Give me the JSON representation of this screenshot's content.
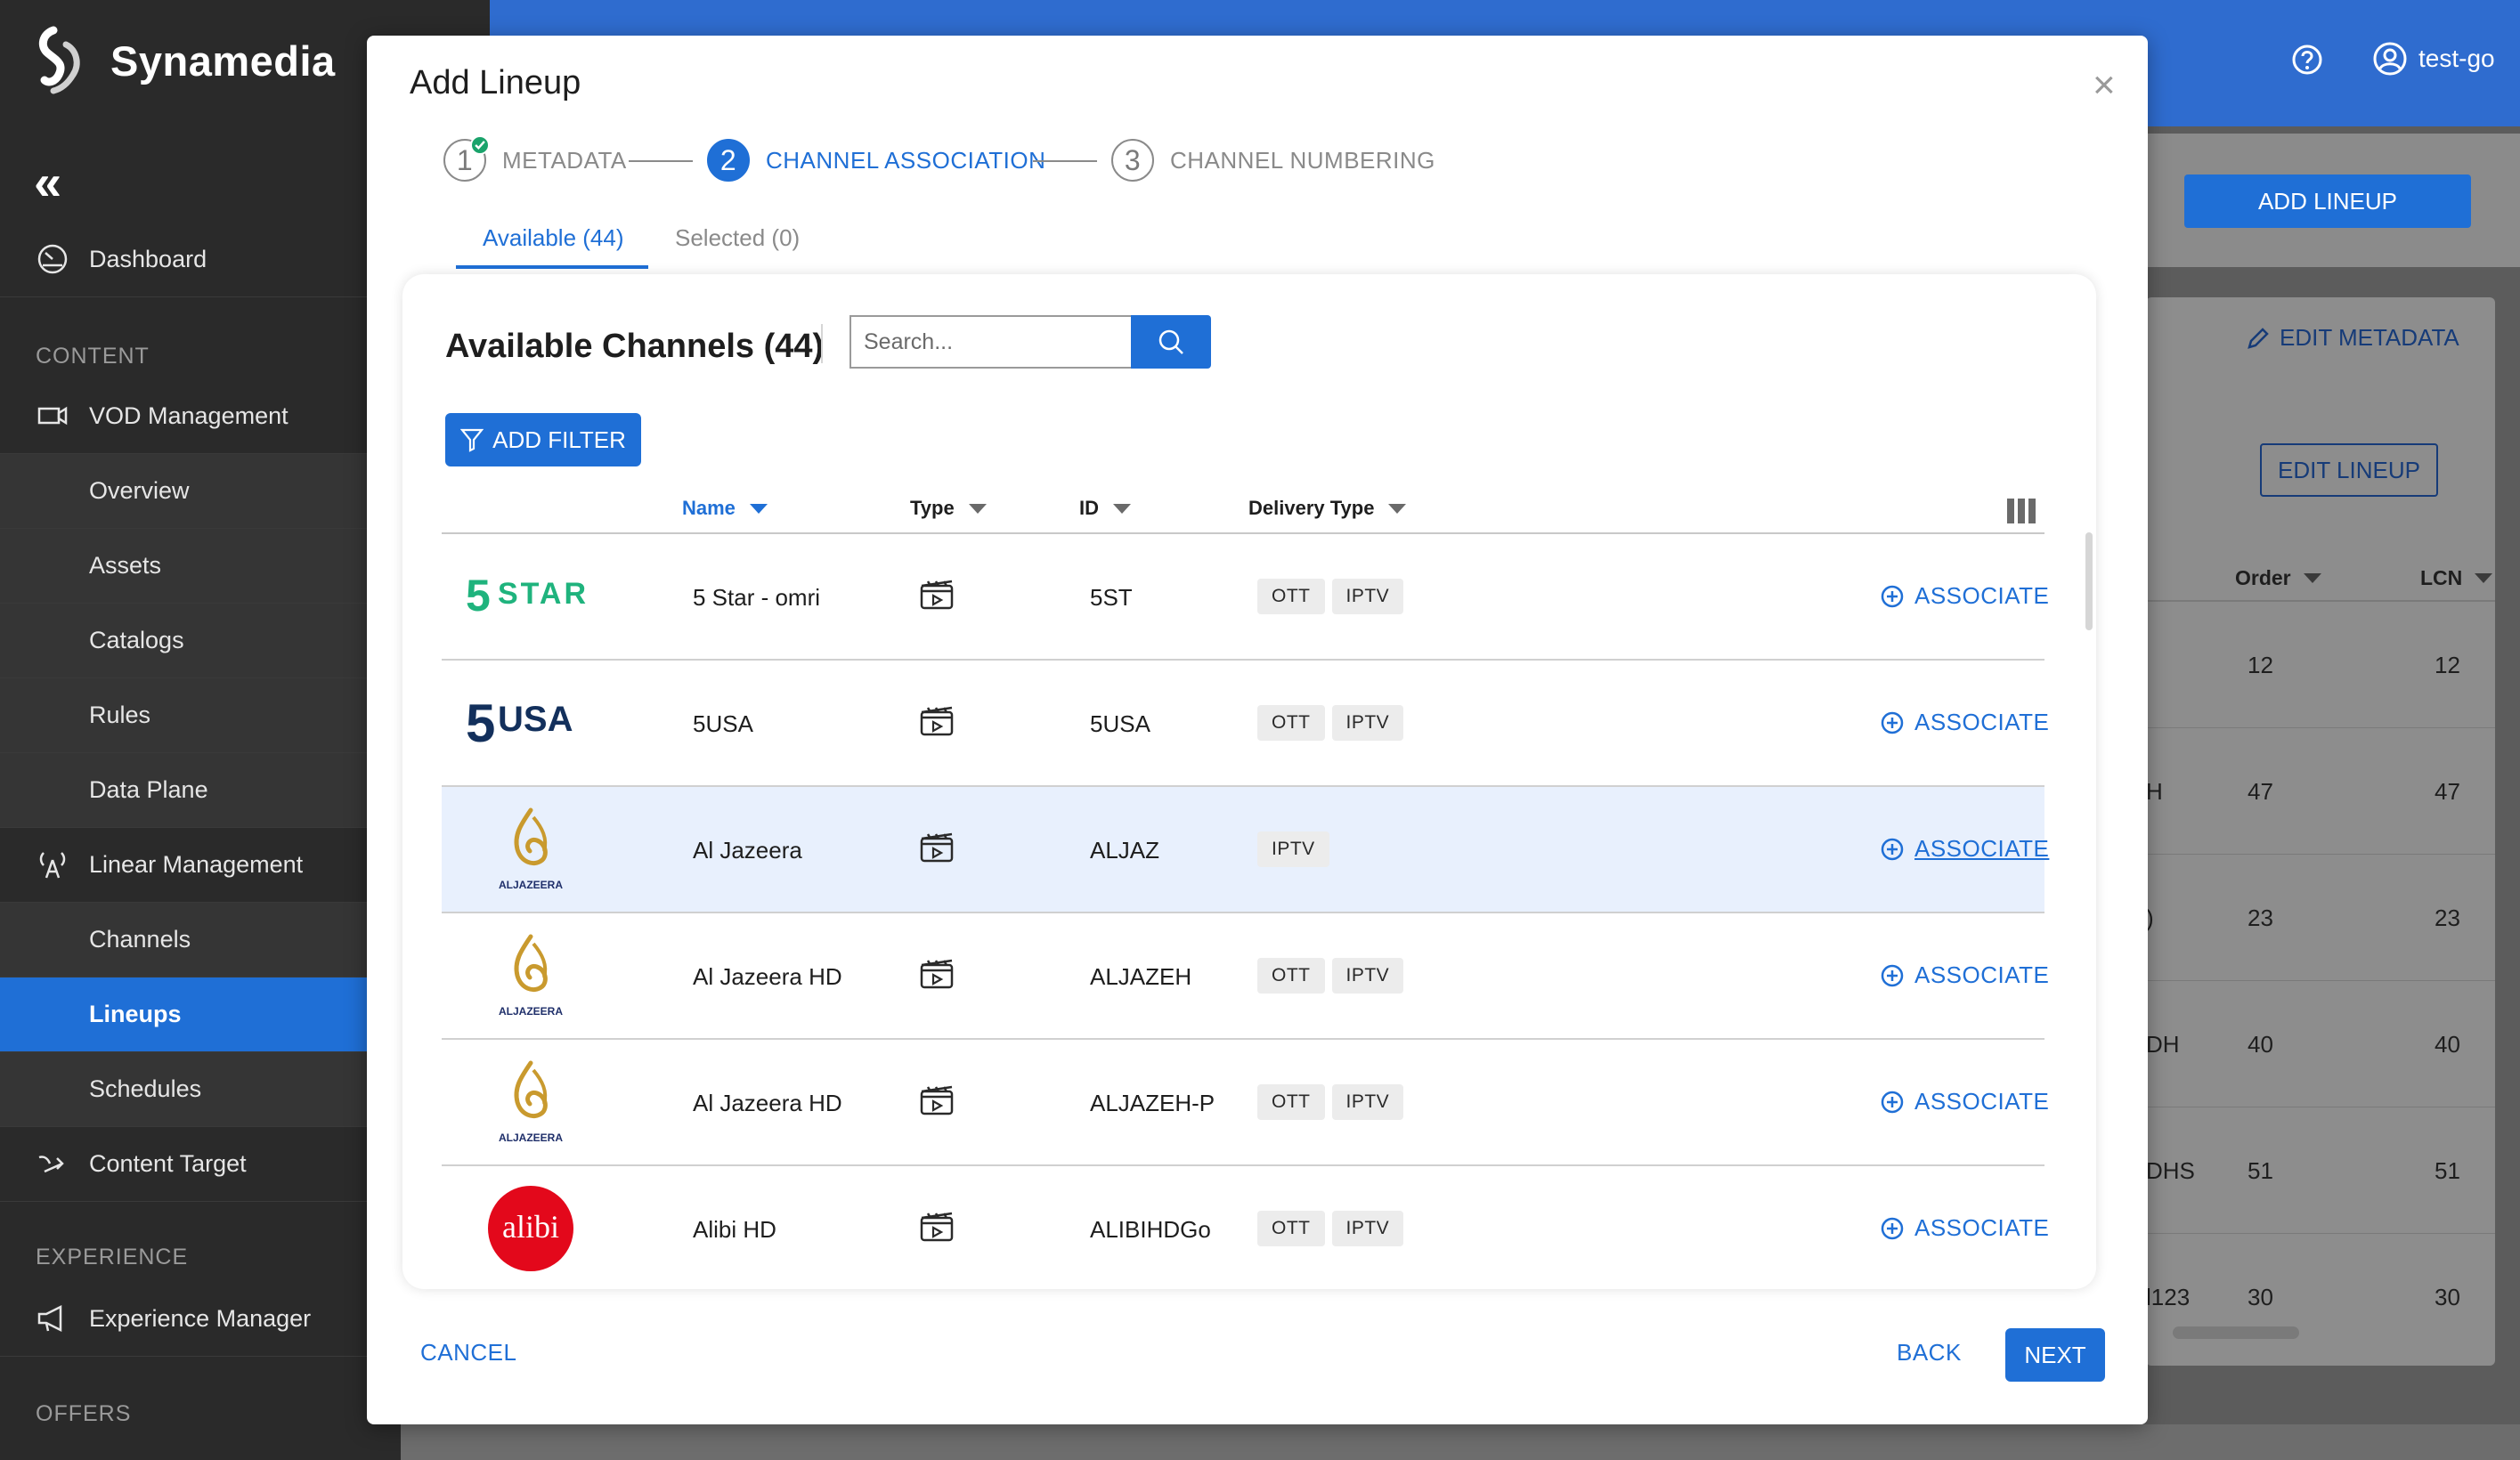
{
  "brand": {
    "name": "Synamedia"
  },
  "header": {
    "help_icon": "help-icon",
    "user_name": "test-go"
  },
  "sidebar": {
    "collapse_label": "«",
    "dashboard": "Dashboard",
    "sections": {
      "content": "CONTENT",
      "experience": "EXPERIENCE",
      "offers": "OFFERS"
    },
    "items": [
      {
        "label": "VOD Management",
        "icon": "video-camera-icon"
      },
      {
        "label": "Overview"
      },
      {
        "label": "Assets"
      },
      {
        "label": "Catalogs"
      },
      {
        "label": "Rules"
      },
      {
        "label": "Data Plane"
      },
      {
        "label": "Linear Management",
        "icon": "broadcast-icon"
      },
      {
        "label": "Channels"
      },
      {
        "label": "Lineups",
        "active": true
      },
      {
        "label": "Schedules"
      },
      {
        "label": "Content Target",
        "icon": "target-arrow-icon"
      },
      {
        "label": "Experience Manager",
        "icon": "megaphone-icon"
      }
    ]
  },
  "background": {
    "add_lineup": "ADD LINEUP",
    "edit_metadata": "EDIT METADATA",
    "edit_lineup": "EDIT LINEUP",
    "columns": [
      "Order",
      "LCN"
    ],
    "rows": [
      {
        "prefix": "",
        "order": "12",
        "lcn": "12"
      },
      {
        "prefix": "H",
        "order": "47",
        "lcn": "47"
      },
      {
        "prefix": ")",
        "order": "23",
        "lcn": "23"
      },
      {
        "prefix": "DH",
        "order": "40",
        "lcn": "40"
      },
      {
        "prefix": "DHS",
        "order": "51",
        "lcn": "51"
      },
      {
        "prefix": "l123",
        "order": "30",
        "lcn": "30"
      }
    ]
  },
  "modal": {
    "title": "Add Lineup",
    "close": "×",
    "steps": [
      {
        "num": "1",
        "label": "METADATA",
        "state": "done"
      },
      {
        "num": "2",
        "label": "CHANNEL ASSOCIATION",
        "state": "active"
      },
      {
        "num": "3",
        "label": "CHANNEL NUMBERING",
        "state": "pending"
      }
    ],
    "tabs": {
      "available": "Available (44)",
      "selected": "Selected (0)"
    },
    "card": {
      "title": "Available Channels (44)",
      "search_placeholder": "Search...",
      "add_filter": "ADD FILTER",
      "columns": {
        "name": "Name",
        "type": "Type",
        "id": "ID",
        "delivery": "Delivery Type"
      }
    },
    "channels": [
      {
        "logo": "5STAR",
        "name": "5 Star - omri",
        "id": "5ST",
        "delivery": [
          "OTT",
          "IPTV"
        ],
        "action": "ASSOCIATE"
      },
      {
        "logo": "5USA",
        "name": "5USA",
        "id": "5USA",
        "delivery": [
          "OTT",
          "IPTV"
        ],
        "action": "ASSOCIATE"
      },
      {
        "logo": "ALJAZEERA",
        "name": "Al Jazeera",
        "id": "ALJAZ",
        "delivery": [
          "IPTV"
        ],
        "action": "ASSOCIATE"
      },
      {
        "logo": "ALJAZEERA",
        "name": "Al Jazeera HD",
        "id": "ALJAZEH",
        "delivery": [
          "OTT",
          "IPTV"
        ],
        "action": "ASSOCIATE"
      },
      {
        "logo": "ALJAZEERA",
        "name": "Al Jazeera HD",
        "id": "ALJAZEH-P",
        "delivery": [
          "OTT",
          "IPTV"
        ],
        "action": "ASSOCIATE"
      },
      {
        "logo": "alibi",
        "name": "Alibi HD",
        "id": "ALIBIHDGo",
        "delivery": [
          "OTT",
          "IPTV"
        ],
        "action": "ASSOCIATE"
      }
    ],
    "footer": {
      "cancel": "CANCEL",
      "back": "BACK",
      "next": "NEXT"
    }
  }
}
